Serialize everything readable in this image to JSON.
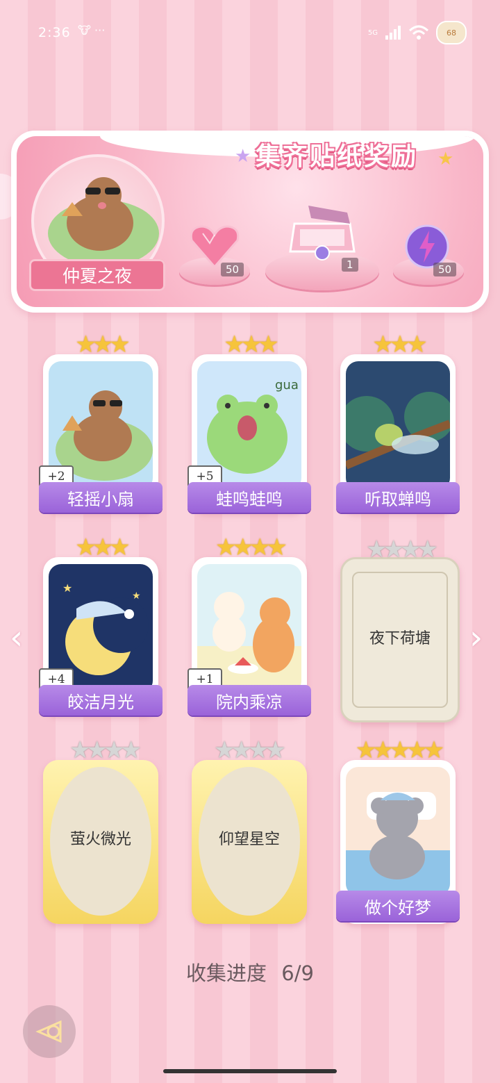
{
  "status": {
    "time": "2:36",
    "extra": "🐮 ···",
    "network": "5G",
    "battery": "68"
  },
  "banner": {
    "title": "集齐贴纸奖励",
    "theme_label": "仲夏之夜",
    "rewards": [
      {
        "icon": "pink-heart-gem-icon",
        "count": "50"
      },
      {
        "icon": "gift-box-icon",
        "count": "1"
      },
      {
        "icon": "purple-lightning-orb-icon",
        "count": "50"
      }
    ]
  },
  "stickers": [
    {
      "name": "轻摇小扇",
      "stars": 3,
      "bonus": "+2",
      "collected": true
    },
    {
      "name": "蛙鸣蛙鸣",
      "stars": 3,
      "bonus": "+5",
      "collected": true
    },
    {
      "name": "听取蝉鸣",
      "stars": 3,
      "bonus": "",
      "collected": true
    },
    {
      "name": "皎洁月光",
      "stars": 3,
      "bonus": "+4",
      "collected": true
    },
    {
      "name": "院内乘凉",
      "stars": 4,
      "bonus": "+1",
      "collected": true
    },
    {
      "name": "夜下荷塘",
      "stars": 4,
      "bonus": "",
      "collected": false
    },
    {
      "name": "萤火微光",
      "stars": 4,
      "bonus": "",
      "collected": false
    },
    {
      "name": "仰望星空",
      "stars": 4,
      "bonus": "",
      "collected": false
    },
    {
      "name": "做个好梦",
      "stars": 5,
      "bonus": "",
      "collected": true
    }
  ],
  "progress": {
    "label": "收集进度",
    "value": "6/9"
  },
  "gua_text": "gua",
  "colors": {
    "accent": "#ec7594",
    "label_purple": "#9a63d9",
    "star_gold": "#f6c43b",
    "star_grey": "#d6d6d6"
  }
}
